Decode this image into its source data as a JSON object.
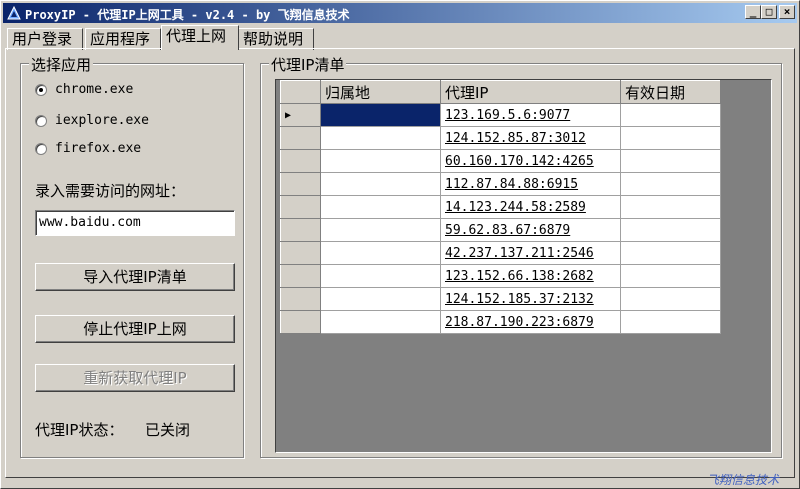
{
  "window": {
    "title": "ProxyIP - 代理IP上网工具 - v2.4 - by 飞翔信息技术",
    "minimize": "_",
    "maximize": "□",
    "close": "×"
  },
  "tabs": [
    {
      "label": "用户登录"
    },
    {
      "label": "应用程序"
    },
    {
      "label": "代理上网"
    },
    {
      "label": "帮助说明"
    }
  ],
  "app_group": {
    "legend": "选择应用",
    "options": [
      {
        "label": "chrome.exe",
        "checked": true
      },
      {
        "label": "iexplore.exe",
        "checked": false
      },
      {
        "label": "firefox.exe",
        "checked": false
      }
    ],
    "url_label": "录入需要访问的网址：",
    "url_value": "www.baidu.com",
    "buttons": {
      "import": "导入代理IP清单",
      "stop": "停止代理IP上网",
      "refresh": "重新获取代理IP"
    },
    "status_label": "代理IP状态：",
    "status_value": "已关闭"
  },
  "proxy_group": {
    "legend": "代理IP清单",
    "columns": [
      "归属地",
      "代理IP",
      "有效日期"
    ],
    "current_row_marker": "▶",
    "rows": [
      {
        "location": "",
        "ip": "123.169.5.6:9077",
        "expiry": ""
      },
      {
        "location": "",
        "ip": "124.152.85.87:3012",
        "expiry": ""
      },
      {
        "location": "",
        "ip": "60.160.170.142:4265",
        "expiry": ""
      },
      {
        "location": "",
        "ip": "112.87.84.88:6915",
        "expiry": ""
      },
      {
        "location": "",
        "ip": "14.123.244.58:2589",
        "expiry": ""
      },
      {
        "location": "",
        "ip": "59.62.83.67:6879",
        "expiry": ""
      },
      {
        "location": "",
        "ip": "42.237.137.211:2546",
        "expiry": ""
      },
      {
        "location": "",
        "ip": "123.152.66.138:2682",
        "expiry": ""
      },
      {
        "location": "",
        "ip": "124.152.185.37:2132",
        "expiry": ""
      },
      {
        "location": "",
        "ip": "218.87.190.223:6879",
        "expiry": ""
      }
    ]
  },
  "watermark": "飞翔信息技术"
}
